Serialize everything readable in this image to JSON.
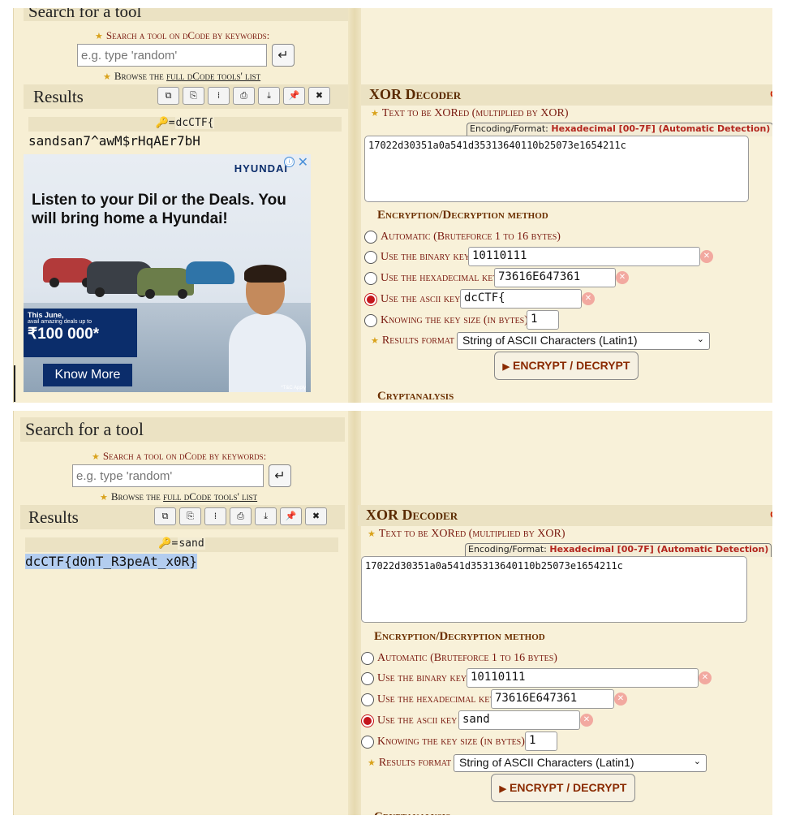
{
  "search": {
    "title": "Search for a tool",
    "keywords_label": "Search a tool on dCode by keywords:",
    "placeholder": "e.g. type 'random'",
    "enter_glyph": "↵",
    "browse_prefix": "Browse the",
    "browse_link": "full dCode tools' list"
  },
  "results": {
    "title": "Results",
    "toolbar_icons": [
      "copy-icon",
      "copy-alt-icon",
      "separator-icon",
      "print-icon",
      "download-icon",
      "pin-icon",
      "close-icon"
    ],
    "toolbar_glyphs": [
      "⧉",
      "⎘",
      "⁞",
      "⎙",
      "⤓",
      "📌",
      "✖"
    ],
    "key_icon": "🔑",
    "top": {
      "key_prefix": "=",
      "key": "dcCTF{",
      "output": "sandsan7^awM$rHqAEr7bH"
    },
    "bottom": {
      "key_prefix": "=",
      "key": "sand",
      "output": "dcCTF{d0nT_R3peAt_x0R}"
    }
  },
  "ad": {
    "brand": "HYUNDAI",
    "headline": "Listen to your Dil or the Deals. You will bring home a Hyundai!",
    "offer_line1": "This June,",
    "offer_line2": "avail amazing deals up to",
    "offer_amount": "₹100 000*",
    "cta": "Know More",
    "tc": "*T&C Apply",
    "info_glyph": "ⓘ",
    "close_glyph": "✕"
  },
  "decoder": {
    "title": "XOR Decoder",
    "reset_glyph": "↺",
    "text_label": "Text to be XORed (multiplied by XOR)",
    "encoding_prefix": "Encoding/Format:",
    "encoding_value": "Hexadecimal [00-7F] (Automatic Detection)",
    "ciphertext": "17022d30351a0a541d35313640110b25073e1654211c",
    "method_title": "Encryption/Decryption method",
    "options": {
      "auto": "Automatic (Bruteforce 1 to 16 bytes)",
      "binary": "Use the binary key",
      "hex": "Use the hexadecimal key",
      "ascii": "Use the ascii key",
      "size": "Knowing the key size (in bytes)"
    },
    "binary_key": "10110111",
    "hex_key": "73616E647361",
    "key_size": "1",
    "format_label": "Results format",
    "format_value": "String of ASCII Characters (Latin1)",
    "button": "ENCRYPT / DECRYPT",
    "cryptanalysis": "Cryptanalysis",
    "top": {
      "ascii_key": "dcCTF{",
      "selected_option": "ascii"
    },
    "bottom": {
      "ascii_key": "sand",
      "selected_option": "ascii"
    }
  }
}
